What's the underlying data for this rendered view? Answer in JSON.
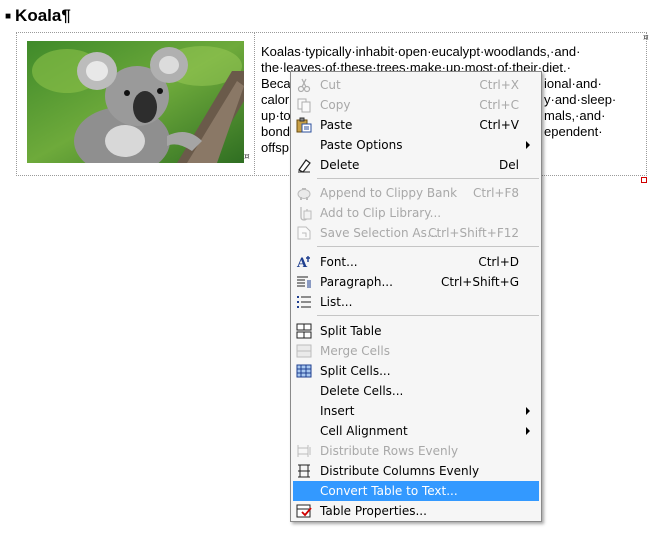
{
  "document": {
    "heading": "Koala¶",
    "cell_end_mark": "¤",
    "paragraph_lines": [
      "Koalas·typically·inhabit·open·eucalypt·woodlands,·and·",
      "the·leaves·of·these·trees·make·up·most·of·their·diet.·",
      "Beca",
      "calor",
      "up·to",
      "bond",
      "offsp"
    ],
    "paragraph_line_tails": [
      "",
      "",
      "",
      "y·and·sleep·",
      "mals,·and·",
      "ependent·",
      ""
    ],
    "paragraph_line_tail_extra": "ional·and·"
  },
  "context_menu": {
    "items": [
      {
        "label": "Cut",
        "shortcut": "Ctrl+X",
        "icon": "scissors-icon",
        "disabled": true
      },
      {
        "label": "Copy",
        "shortcut": "Ctrl+C",
        "icon": "copy-icon",
        "disabled": true
      },
      {
        "label": "Paste",
        "shortcut": "Ctrl+V",
        "icon": "paste-icon",
        "disabled": false
      },
      {
        "label": "Paste Options",
        "shortcut": "",
        "icon": "",
        "disabled": false,
        "submenu": true
      },
      {
        "label": "Delete",
        "shortcut": "Del",
        "icon": "eraser-icon",
        "disabled": false
      },
      {
        "label": "Append to Clippy Bank",
        "shortcut": "Ctrl+F8",
        "icon": "piggy-bank-icon",
        "disabled": true
      },
      {
        "label": "Add to Clip Library...",
        "shortcut": "",
        "icon": "clip-library-icon",
        "disabled": true
      },
      {
        "label": "Save Selection As...",
        "shortcut": "Ctrl+Shift+F12",
        "icon": "save-selection-icon",
        "disabled": true
      },
      {
        "label": "Font...",
        "shortcut": "Ctrl+D",
        "icon": "font-icon",
        "disabled": false
      },
      {
        "label": "Paragraph...",
        "shortcut": "Ctrl+Shift+G",
        "icon": "paragraph-icon",
        "disabled": false
      },
      {
        "label": "List...",
        "shortcut": "",
        "icon": "list-icon",
        "disabled": false
      },
      {
        "label": "Split Table",
        "shortcut": "",
        "icon": "split-table-icon",
        "disabled": false
      },
      {
        "label": "Merge Cells",
        "shortcut": "",
        "icon": "merge-cells-icon",
        "disabled": true
      },
      {
        "label": "Split Cells...",
        "shortcut": "",
        "icon": "split-cells-icon",
        "disabled": false
      },
      {
        "label": "Delete Cells...",
        "shortcut": "",
        "icon": "",
        "disabled": false
      },
      {
        "label": "Insert",
        "shortcut": "",
        "icon": "",
        "disabled": false,
        "submenu": true
      },
      {
        "label": "Cell Alignment",
        "shortcut": "",
        "icon": "",
        "disabled": false,
        "submenu": true
      },
      {
        "label": "Distribute Rows Evenly",
        "shortcut": "",
        "icon": "distribute-rows-icon",
        "disabled": true
      },
      {
        "label": "Distribute Columns Evenly",
        "shortcut": "",
        "icon": "distribute-columns-icon",
        "disabled": false
      },
      {
        "label": "Convert Table to Text...",
        "shortcut": "",
        "icon": "",
        "disabled": false,
        "highlighted": true
      },
      {
        "label": "Table Properties...",
        "shortcut": "",
        "icon": "table-properties-icon",
        "disabled": false
      }
    ]
  },
  "colors": {
    "highlight": "#3399ff",
    "disabled_text": "#a8a8a8",
    "resize_handle": "#d00000"
  }
}
